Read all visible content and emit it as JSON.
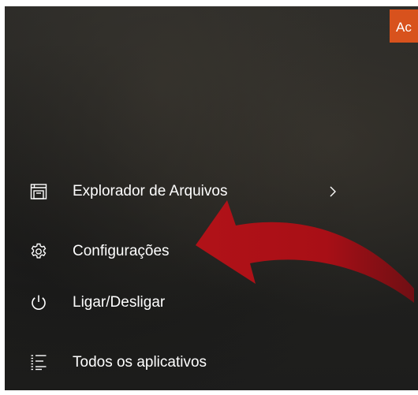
{
  "tile": {
    "label": "Ac",
    "color": "#d8521d"
  },
  "menu": {
    "items": [
      {
        "label": "Explorador de Arquivos",
        "icon": "file-explorer-icon",
        "has_submenu": true
      },
      {
        "label": "Configurações",
        "icon": "gear-icon"
      },
      {
        "label": "Ligar/Desligar",
        "icon": "power-icon"
      },
      {
        "label": "Todos os aplicativos",
        "icon": "all-apps-list-icon"
      }
    ]
  },
  "annotation": {
    "type": "arrow",
    "color": "#b11218",
    "points_to": "Configurações"
  }
}
